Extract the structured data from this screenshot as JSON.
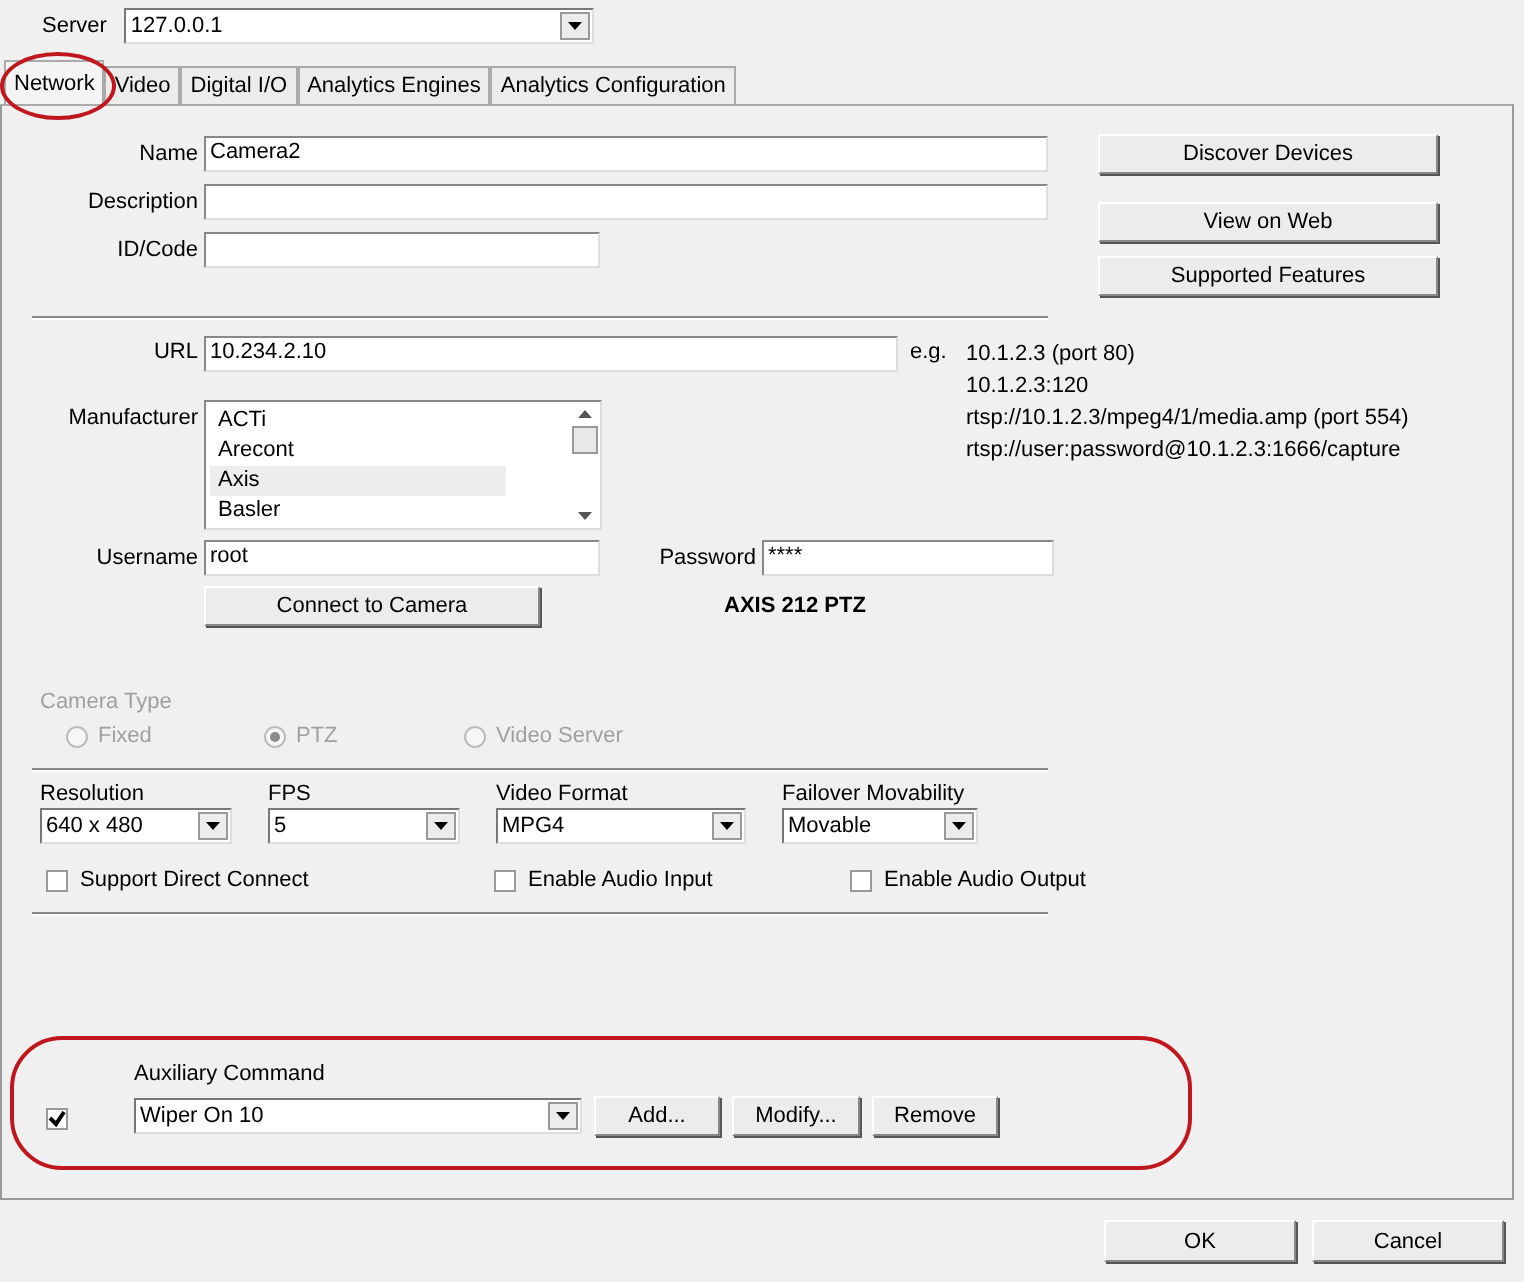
{
  "server": {
    "label": "Server",
    "value": "127.0.0.1"
  },
  "tabs": [
    {
      "label": "Network",
      "selected": true
    },
    {
      "label": "Video",
      "selected": false
    },
    {
      "label": "Digital I/O",
      "selected": false
    },
    {
      "label": "Analytics Engines",
      "selected": false
    },
    {
      "label": "Analytics Configuration",
      "selected": false
    }
  ],
  "identity": [
    {
      "label": "Name",
      "value": "Camera2"
    },
    {
      "label": "Description"
    },
    {
      "label": "ID/Code"
    }
  ],
  "side_buttons": [
    "Discover Devices",
    "View on Web",
    "Supported Features"
  ],
  "url": {
    "label": "URL",
    "value": "10.234.2.10",
    "hint_label": "e.g.",
    "examples": [
      "10.1.2.3 (port 80)",
      "10.1.2.3:120",
      "rtsp://10.1.2.3/mpeg4/1/media.amp (port 554)",
      "rtsp://user:password@10.1.2.3:1666/capture"
    ]
  },
  "manufacturer": {
    "label": "Manufacturer",
    "items": [
      {
        "label": "ACTi",
        "selected": false
      },
      {
        "label": "Arecont",
        "selected": false
      },
      {
        "label": "Axis",
        "selected": true
      },
      {
        "label": "Basler",
        "selected": false
      }
    ]
  },
  "username": {
    "label": "Username",
    "value": "root"
  },
  "password": {
    "label": "Password",
    "value": "****"
  },
  "connect_button": "Connect to Camera",
  "camera_model": "AXIS 212 PTZ",
  "camera_type": {
    "label": "Camera Type",
    "disabled": true,
    "options": [
      {
        "label": "Fixed",
        "selected": false
      },
      {
        "label": "PTZ",
        "selected": true
      },
      {
        "label": "Video Server",
        "selected": false
      }
    ]
  },
  "dropdowns": [
    {
      "label": "Resolution",
      "value": "640 x 480"
    },
    {
      "label": "FPS",
      "value": "5"
    },
    {
      "label": "Video Format",
      "value": "MPG4"
    },
    {
      "label": "Failover Movability",
      "value": "Movable"
    }
  ],
  "options": [
    {
      "label": "Support Direct Connect",
      "checked": false
    },
    {
      "label": "Enable Audio Input",
      "checked": false
    },
    {
      "label": "Enable Audio Output",
      "checked": false
    }
  ],
  "auxiliary": {
    "label": "Auxiliary Command",
    "checked": true,
    "value": "Wiper On 10",
    "buttons": [
      "Add...",
      "Modify...",
      "Remove"
    ]
  },
  "dialog_buttons": [
    "OK",
    "Cancel"
  ]
}
